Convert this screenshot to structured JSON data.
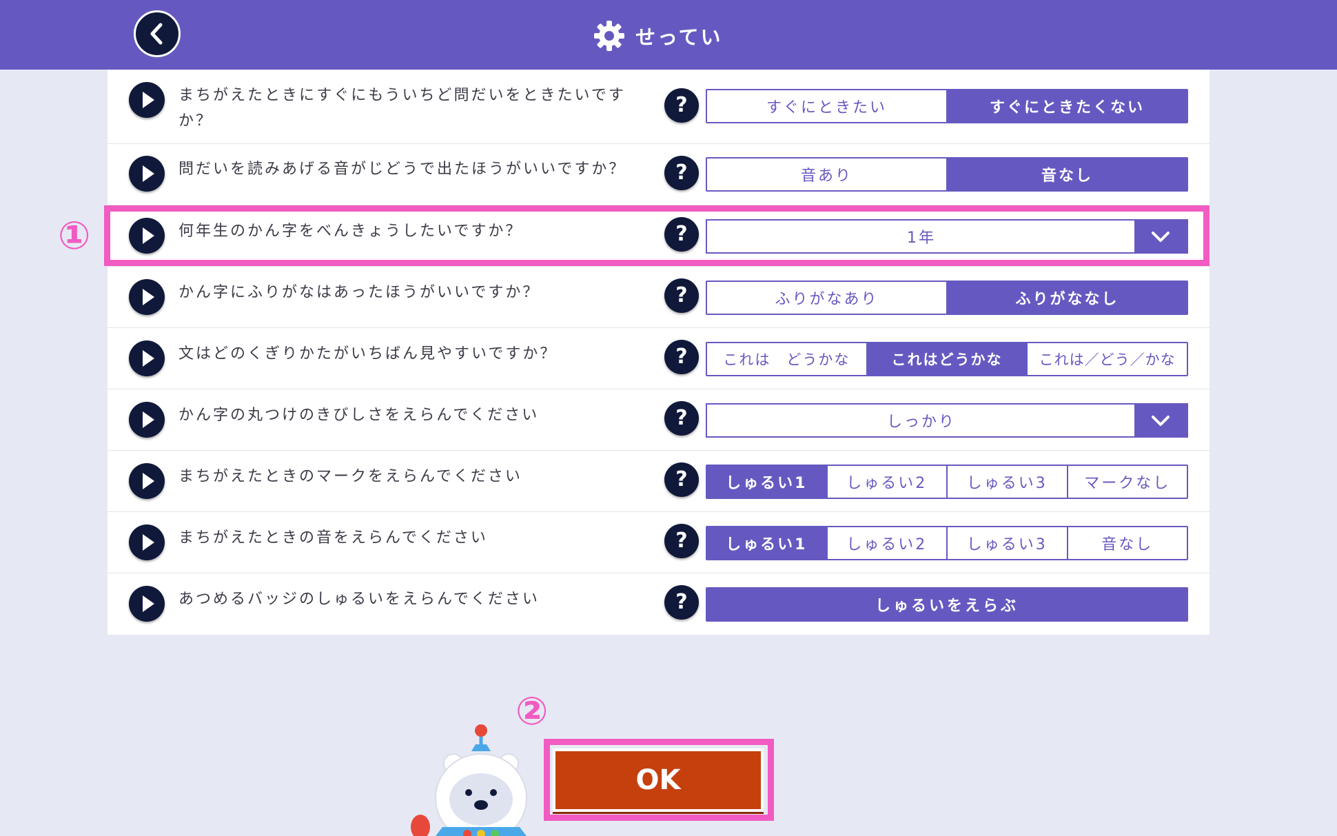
{
  "header": {
    "title": "せってい",
    "back_icon": "back-arrow-icon",
    "title_icon": "gear-icon",
    "color": "#6559c1"
  },
  "settings": [
    {
      "question": "まちがえたときにすぐにもういちど問だいをときたいですか？",
      "type": "segment",
      "options": [
        "すぐにときたい",
        "すぐにときたくない"
      ],
      "selected": 1
    },
    {
      "question": "問だいを読みあげる音がじどうで出たほうがいいですか？",
      "type": "segment",
      "options": [
        "音あり",
        "音なし"
      ],
      "selected": 1
    },
    {
      "question": "何年生のかん字をべんきょうしたいですか？",
      "type": "dropdown",
      "value": "1年"
    },
    {
      "question": "かん字にふりがなはあったほうがいいですか？",
      "type": "segment",
      "options": [
        "ふりがなあり",
        "ふりがななし"
      ],
      "selected": 1
    },
    {
      "question": "文はどのくぎりかたがいちばん見やすいですか？",
      "type": "segment",
      "options": [
        "これは　どうかな",
        "これはどうかな",
        "これは／どう／かな"
      ],
      "selected": 1
    },
    {
      "question": "かん字の丸つけのきびしさをえらんでください",
      "type": "dropdown",
      "value": "しっかり"
    },
    {
      "question": "まちがえたときのマークをえらんでください",
      "type": "segment",
      "options": [
        "しゅるい1",
        "しゅるい2",
        "しゅるい3",
        "マークなし"
      ],
      "selected": 0
    },
    {
      "question": "まちがえたときの音をえらんでください",
      "type": "segment",
      "options": [
        "しゅるい1",
        "しゅるい2",
        "しゅるい3",
        "音なし"
      ],
      "selected": 0
    },
    {
      "question": "あつめるバッジのしゅるいをえらんでください",
      "type": "button",
      "label": "しゅるいをえらぶ"
    }
  ],
  "help_label": "?",
  "callouts": {
    "one": "①",
    "two": "②",
    "color": "#f25bc1"
  },
  "ok_button": {
    "label": "OK",
    "color": "#c6400e"
  },
  "mascot_icon": "robot-bear-mascot-icon"
}
